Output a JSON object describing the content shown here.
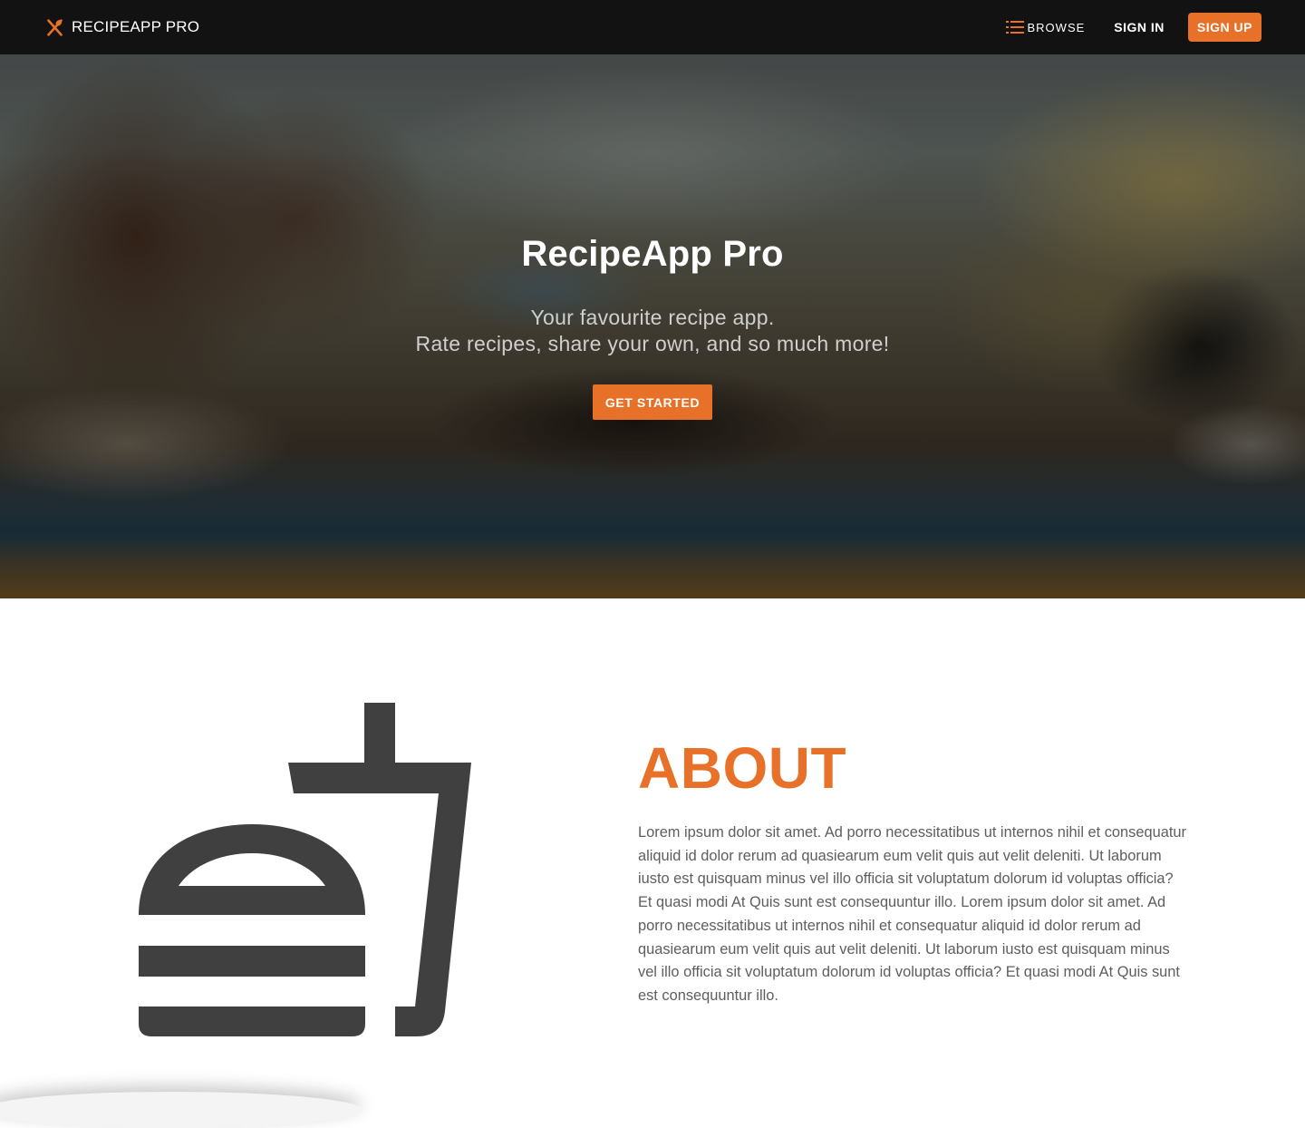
{
  "nav": {
    "brand": "RECIPEAPP PRO",
    "brand_icon": "fork-spoon-icon",
    "browse_label": "BROWSE",
    "browse_icon": "list-icon",
    "signin_label": "SIGN IN",
    "signup_label": "SIGN UP"
  },
  "hero": {
    "title": "RecipeApp Pro",
    "subtitle_line1": "Your favourite recipe app.",
    "subtitle_line2": "Rate recipes, share your own, and so much more!",
    "cta_label": "GET STARTED"
  },
  "about": {
    "illustration_icon": "burger-drink-icon",
    "title": "ABOUT",
    "body": "Lorem ipsum dolor sit amet. Ad porro necessitatibus ut internos nihil et consequatur aliquid id dolor rerum ad quasiearum eum velit quis aut velit deleniti. Ut laborum iusto est quisquam minus vel illo officia sit voluptatum dolorum id voluptas officia? Et quasi modi At Quis sunt est consequuntur illo. Lorem ipsum dolor sit amet. Ad porro necessitatibus ut internos nihil et consequatur aliquid id dolor rerum ad quasiearum eum velit quis aut velit deleniti. Ut laborum iusto est quisquam minus vel illo officia sit voluptatum dolorum id voluptas officia? Et quasi modi At Quis sunt est consequuntur illo."
  },
  "colors": {
    "accent": "#e8712a",
    "navbar": "#121212",
    "icon_dark": "#404040",
    "body_text": "#5e5e5e"
  }
}
